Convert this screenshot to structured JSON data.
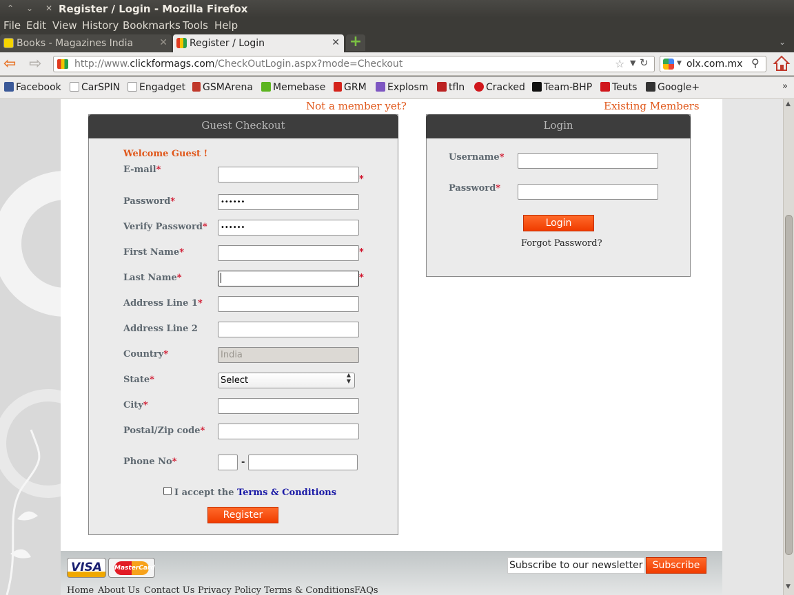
{
  "window": {
    "title": "Register / Login - Mozilla Firefox"
  },
  "menu": [
    "File",
    "Edit",
    "View",
    "History",
    "Bookmarks",
    "Tools",
    "Help"
  ],
  "tabs": [
    {
      "label": "Books - Magazines India"
    },
    {
      "label": "Register / Login"
    }
  ],
  "url": {
    "prefix": "http://www.",
    "domain": "clickformags.com",
    "path": "/CheckOutLogin.aspx?mode=Checkout"
  },
  "search": {
    "value": "olx.com.mx"
  },
  "bookmarks": [
    "Facebook",
    "CarSPIN",
    "Engadget",
    "GSMArena",
    "Memebase",
    "GRM",
    "Explosm",
    "tfln",
    "Cracked",
    "Team-BHP",
    "Teuts",
    "Google+"
  ],
  "header": {
    "not_member": "Not a member yet?",
    "existing": "Existing Members"
  },
  "guest": {
    "title": "Guest Checkout",
    "welcome": "Welcome Guest !",
    "labels": {
      "email": "E-mail",
      "password": "Password",
      "verify": "Verify Password",
      "first": "First Name",
      "last": "Last Name",
      "addr1": "Address Line 1",
      "addr2": "Address Line 2",
      "country": "Country",
      "state": "State",
      "city": "City",
      "postal": "Postal/Zip code",
      "phone": "Phone No"
    },
    "values": {
      "password": "••••••",
      "verify": "••••••",
      "country": "India",
      "state": "Select"
    },
    "accept_prefix": "I accept the",
    "terms": "Terms & Conditions",
    "register": "Register"
  },
  "login": {
    "title": "Login",
    "username": "Username",
    "password": "Password",
    "button": "Login",
    "forgot": "Forgot Password?"
  },
  "footer": {
    "visa": "VISA",
    "mastercard": "MasterCard",
    "newsletter_placeholder": "Subscribe to our newsletter",
    "subscribe": "Subscribe",
    "links": [
      "Home",
      "About Us",
      "Contact Us",
      "Privacy Policy",
      "Terms & Conditions",
      "FAQs"
    ]
  }
}
